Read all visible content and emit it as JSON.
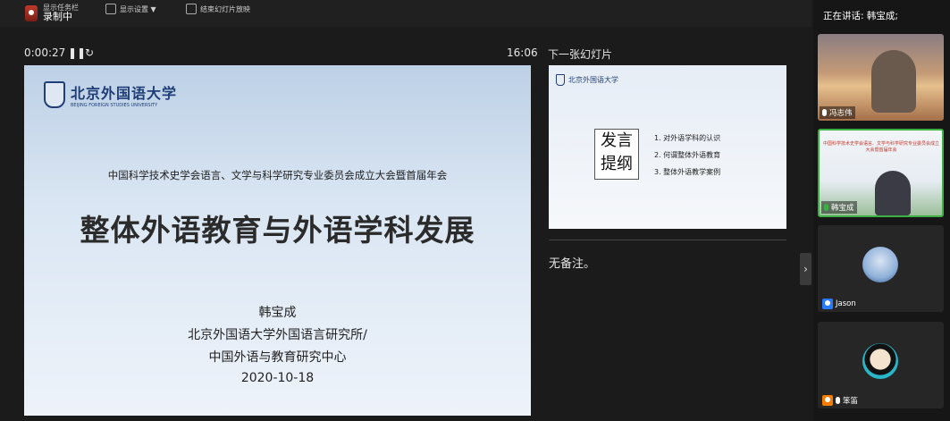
{
  "toolbar": {
    "record_label": "录制中",
    "taskbar_label": "显示任务栏",
    "display_settings_label": "显示设置 ▼",
    "end_show_label": "结束幻灯片放映"
  },
  "presenter": {
    "elapsed": "0:00:27",
    "pause_icon": "pause-icon",
    "restart_icon": "restart-icon",
    "clock": "16:06",
    "next_slide_label": "下一张幻灯片",
    "notes": "无备注。"
  },
  "current_slide": {
    "logo_cn": "北京外国语大学",
    "logo_en": "BEIJING FOREIGN STUDIES UNIVERSITY",
    "conference": "中国科学技术史学会语言、文学与科学研究专业委员会成立大会暨首届年会",
    "title": "整体外语教育与外语学科发展",
    "author": "韩宝成",
    "affiliation_line1": "北京外国语大学外国语言研究所/",
    "affiliation_line2": "中国外语与教育研究中心",
    "date": "2020-10-18"
  },
  "next_slide": {
    "logo_cn": "北京外国语大学",
    "box_line1": "发言",
    "box_line2": "提纲",
    "outline": [
      "1. 对外语学科的认识",
      "2. 何谓整体外语教育",
      "3. 整体外语教学案例"
    ]
  },
  "participants": {
    "speaking_label": "正在讲话: 韩宝成;",
    "list": [
      {
        "name": "冯志伟"
      },
      {
        "name": "韩宝成",
        "slide_text": "中国科学技术史学会语言、文学与科学研究专业委员会成立大会暨首届年会"
      },
      {
        "name": "Jason"
      },
      {
        "name": "笨笛"
      }
    ]
  },
  "colors": {
    "accent_blue": "#2979ff",
    "active_border": "#3cb043",
    "record_red": "#c0392b"
  }
}
